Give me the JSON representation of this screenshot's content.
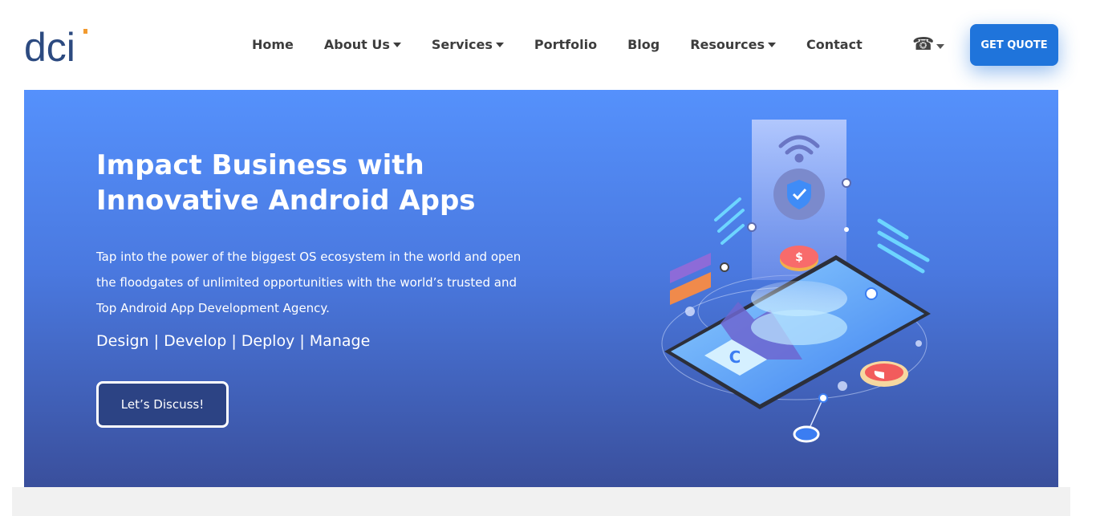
{
  "brand": {
    "logo_text": "dci",
    "accent": "#1f74db",
    "logo_dot_color": "#f29a2e"
  },
  "nav": {
    "items": [
      {
        "label": "Home",
        "dropdown": false
      },
      {
        "label": "About Us",
        "dropdown": true
      },
      {
        "label": "Services",
        "dropdown": true
      },
      {
        "label": "Portfolio",
        "dropdown": false
      },
      {
        "label": "Blog",
        "dropdown": false
      },
      {
        "label": "Resources",
        "dropdown": true
      },
      {
        "label": "Contact",
        "dropdown": false
      }
    ],
    "phone_icon": "phone-icon",
    "cta_label": "GET QUOTE"
  },
  "hero": {
    "title_line1": "Impact Business with",
    "title_line2": "Innovative Android Apps",
    "text_line1": "Tap into the power of the biggest OS ecosystem in the world and open",
    "text_line2": "the floodgates of unlimited opportunities with the world’s trusted and",
    "text_line3": "Top Android App Development Agency.",
    "tagline": "Design | Develop | Deploy | Manage",
    "button_label": "Let’s Discuss!",
    "gradient_top": "#5591fc",
    "gradient_bottom": "#3a4f9c",
    "illustration": "isometric-smartphone-illustration"
  }
}
